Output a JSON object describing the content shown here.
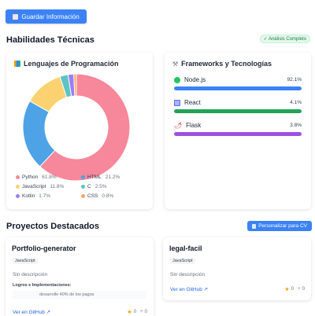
{
  "header": {
    "save_button": "Guardar Información"
  },
  "skills": {
    "title": "Habilidades Técnicas",
    "status_badge": "✓ Análisis Completo",
    "languages": {
      "title": "Lenguajes de Programación",
      "icon": "bar-chart-icon",
      "items": [
        {
          "name": "Python",
          "pct": "61.8%",
          "color": "#f7879a"
        },
        {
          "name": "HTML",
          "pct": "21.2%",
          "color": "#4ea3e6"
        },
        {
          "name": "JavaScript",
          "pct": "11.8%",
          "color": "#fcd270"
        },
        {
          "name": "C",
          "pct": "2.5%",
          "color": "#5fc3c3"
        },
        {
          "name": "Kotlin",
          "pct": "1.7%",
          "color": "#9a7ef5"
        },
        {
          "name": "CSS",
          "pct": "0.8%",
          "color": "#ffa560"
        }
      ],
      "chart_data": {
        "type": "pie",
        "donut": true,
        "categories": [
          "Python",
          "HTML",
          "JavaScript",
          "C",
          "Kotlin",
          "CSS"
        ],
        "values": [
          61.8,
          21.2,
          11.8,
          2.5,
          1.7,
          0.8
        ],
        "colors": [
          "#f7879a",
          "#4ea3e6",
          "#fcd270",
          "#5fc3c3",
          "#9a7ef5",
          "#ffa560"
        ]
      }
    },
    "frameworks": {
      "title": "Frameworks y Tecnologías",
      "icon": "tools-icon",
      "items": [
        {
          "name": "Node.js",
          "pct": "92.1%",
          "value": 92.1,
          "color": "#3b82f6",
          "icon": "nodejs-icon"
        },
        {
          "name": "React",
          "pct": "4.1%",
          "value": 4.1,
          "color": "#22a35a",
          "icon": "react-icon"
        },
        {
          "name": "Flask",
          "pct": "3.8%",
          "value": 3.8,
          "color": "#9b51e0",
          "icon": "flask-icon"
        }
      ]
    }
  },
  "projects": {
    "title": "Proyectos Destacados",
    "cv_button": "Personalizar para CV",
    "items": [
      {
        "name": "Portfolio-generator",
        "language": "JavaScript",
        "description": "Sin descripción",
        "achievements_label": "Logros e Implementaciones:",
        "achievement": "desarrolle 40% de los pagos",
        "link": "Ver en GitHub ↗",
        "stars": "0",
        "forks": "0"
      },
      {
        "name": "legal-facil",
        "language": "JavaScript",
        "description": "Sin descripción",
        "link": "Ver en GitHub ↗",
        "stars": "0",
        "forks": "0"
      }
    ]
  }
}
